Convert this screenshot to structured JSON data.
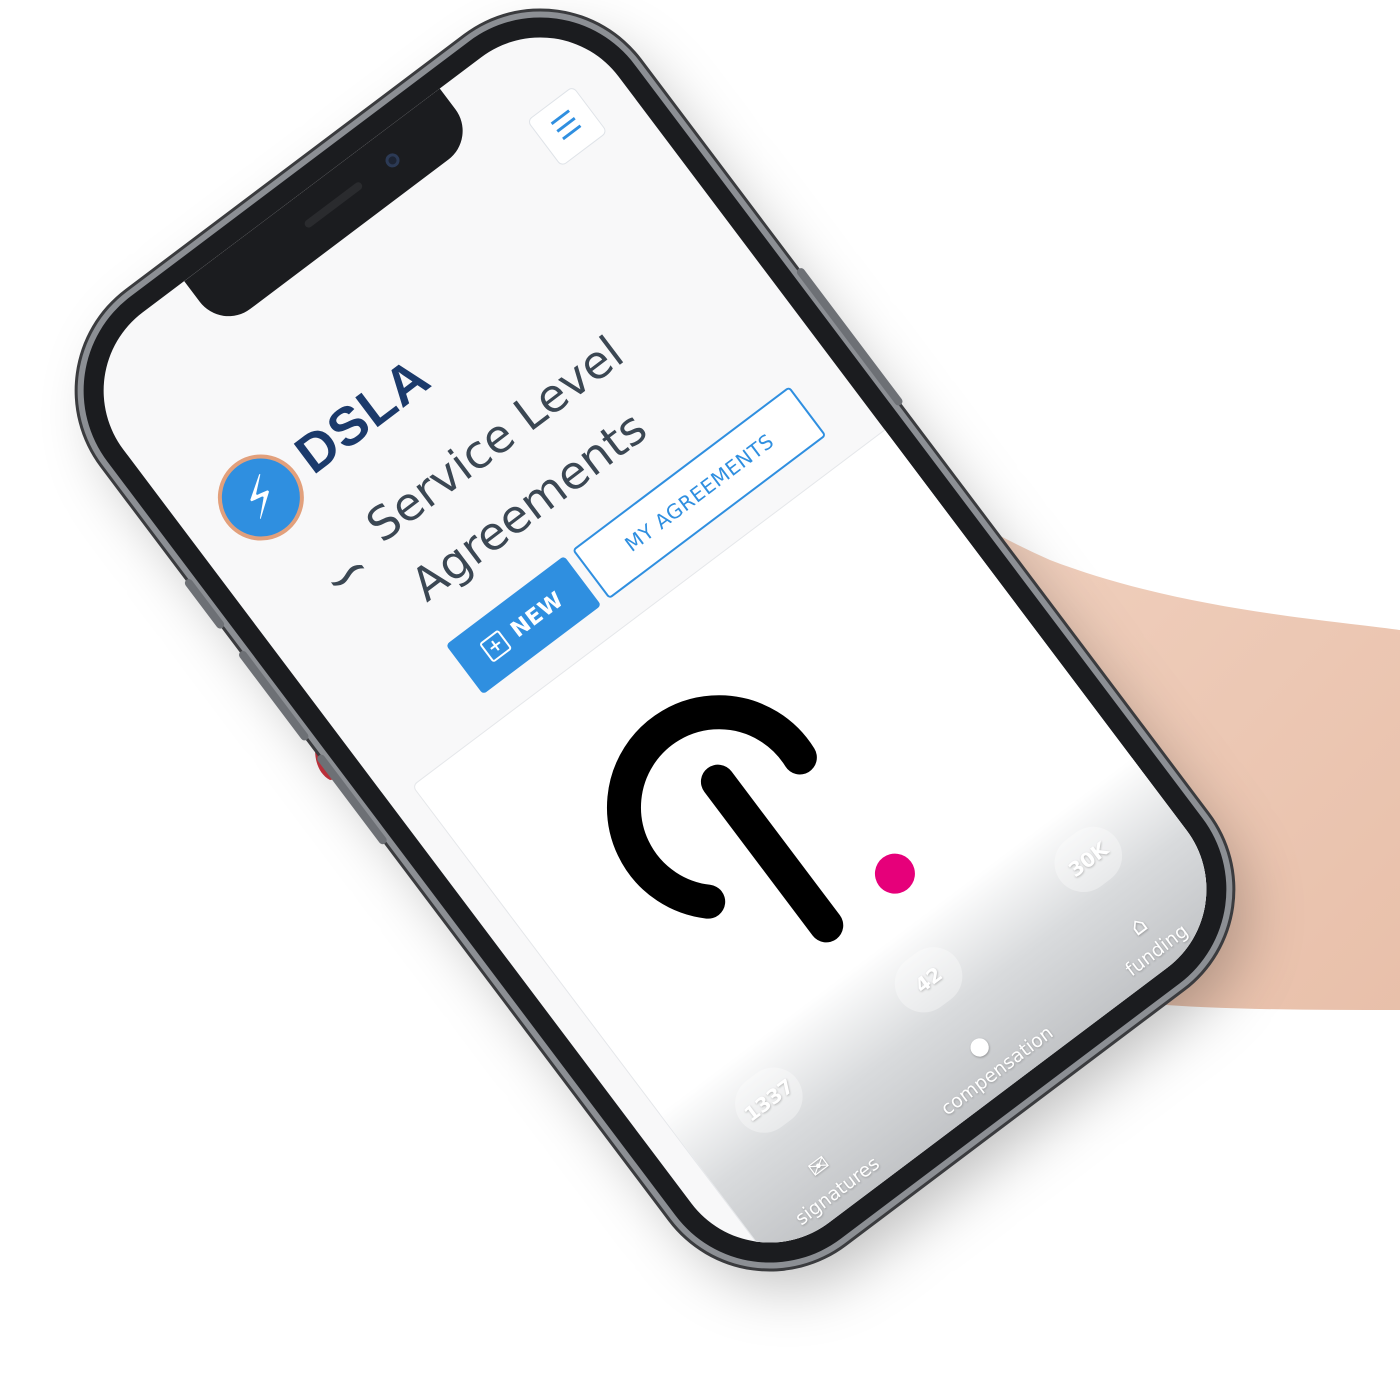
{
  "header": {
    "menu_icon": "hamburger-icon",
    "logo_icon": "lightning-bolt-icon",
    "brand": "DSLA"
  },
  "hero": {
    "script_icon": "signature-icon",
    "title": "Service Level Agreements"
  },
  "actions": {
    "new_label": "NEW",
    "new_icon": "plus-square-icon",
    "my_agreements_label": "MY AGREEMENTS"
  },
  "card": {
    "logo": "polkadot-logo",
    "stats": [
      {
        "value": "1337",
        "label": "signatures",
        "icon": "handshake-icon"
      },
      {
        "value": "42",
        "label": "compensation",
        "icon": "coins-icon"
      },
      {
        "value": "30K",
        "label": "funding",
        "icon": "funding-icon"
      }
    ]
  },
  "colors": {
    "accent": "#2f8fe0",
    "brand_text": "#1b3a6b",
    "polkadot_pink": "#e6007a"
  }
}
